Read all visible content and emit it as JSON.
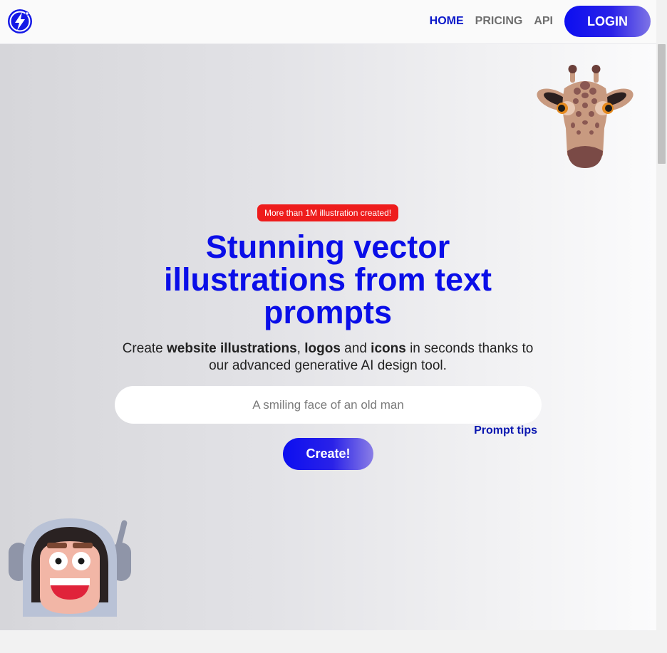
{
  "nav": {
    "logo_icon": "lightning-bolt-logo-icon",
    "links": [
      {
        "label": "HOME",
        "active": true
      },
      {
        "label": "PRICING",
        "active": false
      },
      {
        "label": "API",
        "active": false
      }
    ],
    "login_label": "LOGIN"
  },
  "hero": {
    "badge": "More than 1M illustration created!",
    "title": "Stunning vector illustrations from text prompts",
    "subtitle": {
      "t1": "Create ",
      "b1": "website illustrations",
      "t2": ", ",
      "b2": "logos",
      "t3": " and ",
      "b3": "icons",
      "t4": " in seconds thanks to our advanced generative AI design tool."
    },
    "prompt_placeholder": "A smiling face of an old man",
    "tips_label": "Prompt tips",
    "create_label": "Create!"
  },
  "colors": {
    "brand_blue": "#0a0ee8",
    "badge_red": "#ee1c1c"
  },
  "illustrations": [
    "giraffe-head-illustration",
    "astronaut-face-illustration"
  ]
}
